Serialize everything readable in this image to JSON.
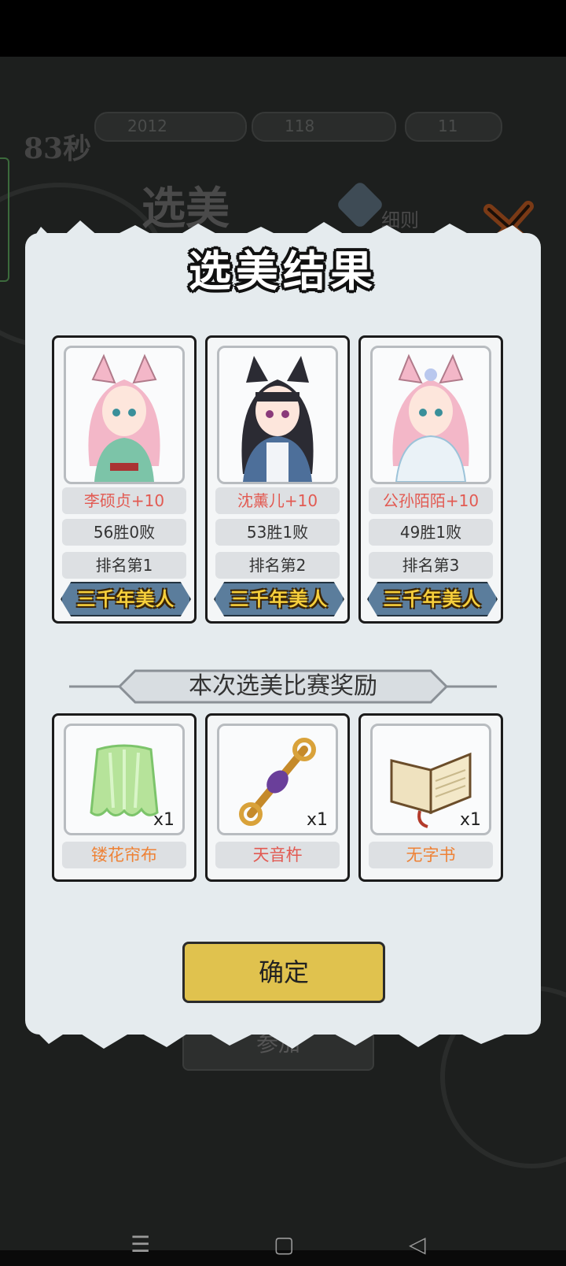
{
  "background": {
    "title": "选美",
    "rules_label": "细则",
    "timer": "83秒",
    "resources": [
      "2012",
      "118",
      "11"
    ],
    "join_label": "参加"
  },
  "dialog": {
    "title": "选美结果",
    "contestants": [
      {
        "name": "李硕贞+10",
        "record": "56胜0败",
        "rank": "排名第1",
        "title": "三千年美人",
        "hair": "#f3b7c8",
        "dress": "#7cc4a8"
      },
      {
        "name": "沈薰儿+10",
        "record": "53胜1败",
        "rank": "排名第2",
        "title": "三千年美人",
        "hair": "#2b2b33",
        "dress": "#4d6f9a"
      },
      {
        "name": "公孙陌陌+10",
        "record": "49胜1败",
        "rank": "排名第3",
        "title": "三千年美人",
        "hair": "#f3b7c8",
        "dress": "#eaf2f7"
      }
    ],
    "rewards_heading": "本次选美比赛奖励",
    "rewards": [
      {
        "name": "镂花帘布",
        "qty": "x1",
        "icon": "cloth-icon"
      },
      {
        "name": "天音杵",
        "qty": "x1",
        "icon": "vajra-icon"
      },
      {
        "name": "无字书",
        "qty": "x1",
        "icon": "book-icon"
      }
    ],
    "confirm_label": "确定"
  },
  "nav": {
    "menu": "☰",
    "home": "▢",
    "back": "◁"
  },
  "colors": {
    "panel": "#e5ebee",
    "confirm": "#e0c24e",
    "name_text": "#e25a52",
    "reward_text": "#ee8236"
  }
}
